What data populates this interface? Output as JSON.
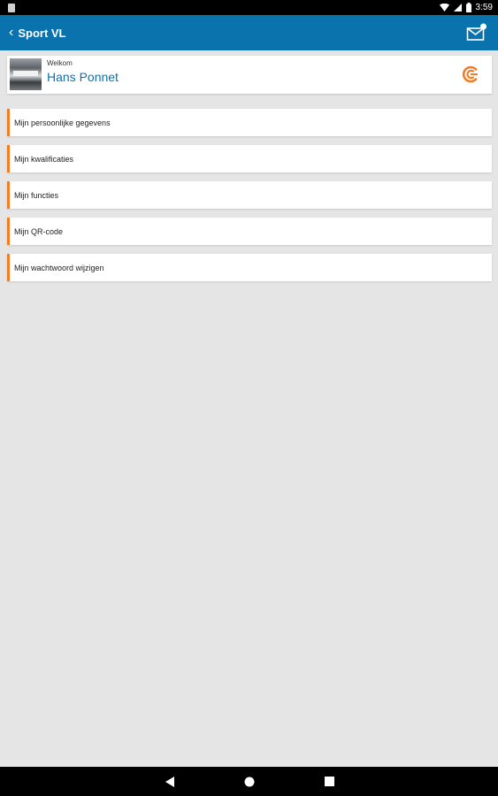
{
  "status_bar": {
    "time": "3:59"
  },
  "app_bar": {
    "title": "Sport VL",
    "back_icon": "chevron-left-icon",
    "mail_icon": "mail-notification-icon",
    "color": "#0a72ad"
  },
  "welcome": {
    "label": "Welkom",
    "name": "Hans Ponnet",
    "logo_icon": "brand-logo-icon",
    "accent": "#f07c24"
  },
  "menu": {
    "items": [
      {
        "label": "Mijn persoonlijke gegevens"
      },
      {
        "label": "Mijn kwalificaties"
      },
      {
        "label": "Mijn functies"
      },
      {
        "label": "Mijn QR-code"
      },
      {
        "label": "Mijn wachtwoord wijzigen"
      }
    ]
  },
  "nav_bar": {
    "back_icon": "nav-back-icon",
    "home_icon": "nav-home-icon",
    "recents_icon": "nav-recents-icon"
  }
}
